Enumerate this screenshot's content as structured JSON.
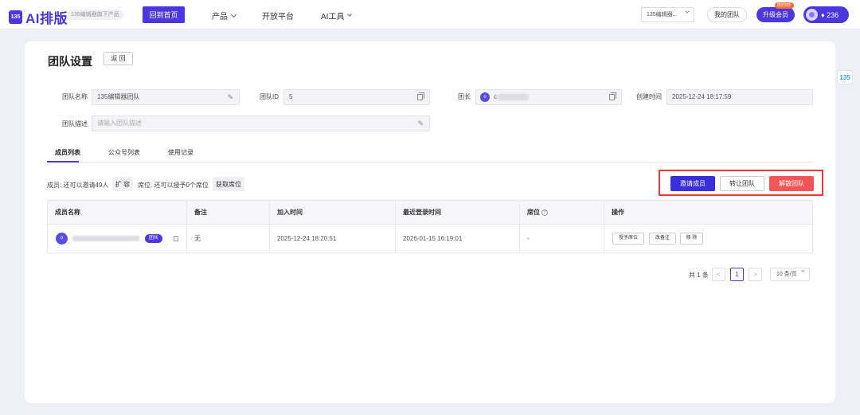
{
  "topbar": {
    "logo_mark": "135",
    "logo_text": "AI排版",
    "logo_sub": "135编辑器旗下产品",
    "home_label": "回到首页",
    "nav": [
      "产品",
      "开放平台",
      "AI工具"
    ],
    "team_select": "135编辑器...",
    "my_team": "我的团队",
    "upgrade_badge": "限时8折",
    "upgrade_label": "升级会员",
    "coins": "♦ 236"
  },
  "side_badge": "135",
  "page": {
    "title": "团队设置",
    "back_label": "返 回"
  },
  "form": {
    "team_name_label": "团队名称",
    "team_name_value": "135编辑器团队",
    "team_id_label": "团队ID",
    "team_id_value": "5",
    "leader_label": "团长",
    "leader_prefix": "c",
    "created_label": "创建时间",
    "created_value": "2025-12-24 18:17:59",
    "desc_label": "团队描述",
    "desc_placeholder": "请输入团队描述"
  },
  "tabs": [
    "成员列表",
    "公众号列表",
    "使用记录"
  ],
  "toolbar": {
    "members_info": "成员: 还可以邀请49人",
    "expand_label": "扩 容",
    "seats_info": "席位: 还可以授予0个席位",
    "seats_btn": "获取席位",
    "invite_label": "邀请成员",
    "transfer_label": "转让团队",
    "disband_label": "解散团队"
  },
  "table": {
    "headers": [
      "成员名称",
      "备注",
      "加入时间",
      "最近登录时间",
      "席位",
      "操作"
    ],
    "rows": [
      {
        "avatar": "o",
        "leader_badge": "团长",
        "note": "无",
        "join_time": "2025-12-24 18:20:51",
        "last_login": "2026-01-15 16:19:01",
        "seat": "-",
        "actions": [
          "授予席位",
          "改备注",
          "移 除"
        ]
      }
    ]
  },
  "pagination": {
    "total": "共 1 条",
    "prev": "<",
    "current": "1",
    "next": ">",
    "page_size": "10 条/页"
  }
}
